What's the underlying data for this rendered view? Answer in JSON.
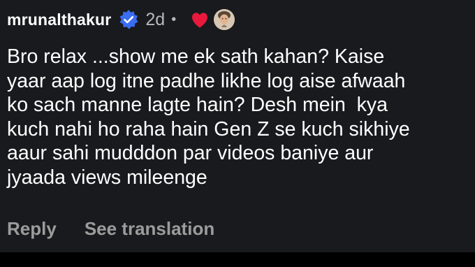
{
  "comment": {
    "username": "mrunalthakur",
    "verified_icon": "verified-badge-icon",
    "time": "2d",
    "separator": "•",
    "liked_icon": "heart-icon",
    "like_color": "#e8193c",
    "verified_color": "#3a6df0",
    "text_lines": [
      "Bro relax ...show me ek sath kahan? Kaise",
      "yaar aap log itne padhe likhe log aise afwaah",
      "ko sach manne lagte hain? Desh mein  kya",
      "kuch nahi ho raha hain Gen Z se kuch sikhiye",
      "aaur sahi mudddon par videos baniye aur",
      "jyaada views mileenge"
    ]
  },
  "actions": {
    "reply_label": "Reply",
    "translate_label": "See translation"
  }
}
